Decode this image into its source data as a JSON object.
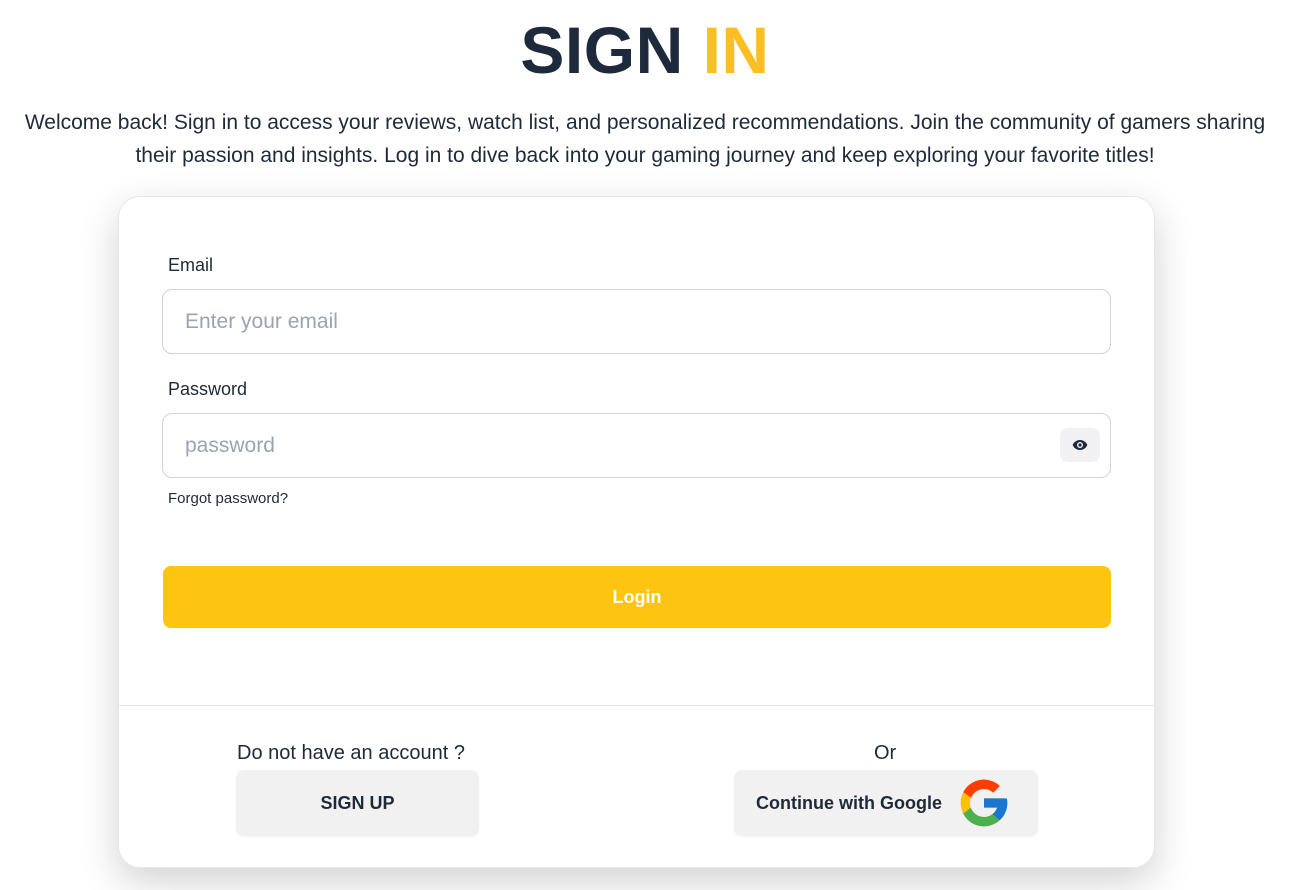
{
  "header": {
    "title_part1": "SIGN",
    "title_part2": "IN",
    "subtitle": "Welcome back! Sign in to access your reviews, watch list, and personalized recommendations. Join the community of gamers sharing their passion and insights. Log in to dive back into your gaming journey and keep exploring your favorite titles!"
  },
  "form": {
    "email_label": "Email",
    "email_placeholder": "Enter your email",
    "email_value": "",
    "password_label": "Password",
    "password_placeholder": "password",
    "password_value": "",
    "forgot_link": "Forgot password?",
    "login_button": "Login"
  },
  "footer": {
    "no_account_text": "Do not have an account ?",
    "signup_button": "SIGN UP",
    "or_text": "Or",
    "google_button": "Continue with Google"
  },
  "icons": {
    "password_toggle": "eye-icon",
    "google": "google-g-icon"
  },
  "colors": {
    "accent": "#fec412",
    "title_dark": "#1e293b",
    "title_accent": "#fbbf24"
  }
}
